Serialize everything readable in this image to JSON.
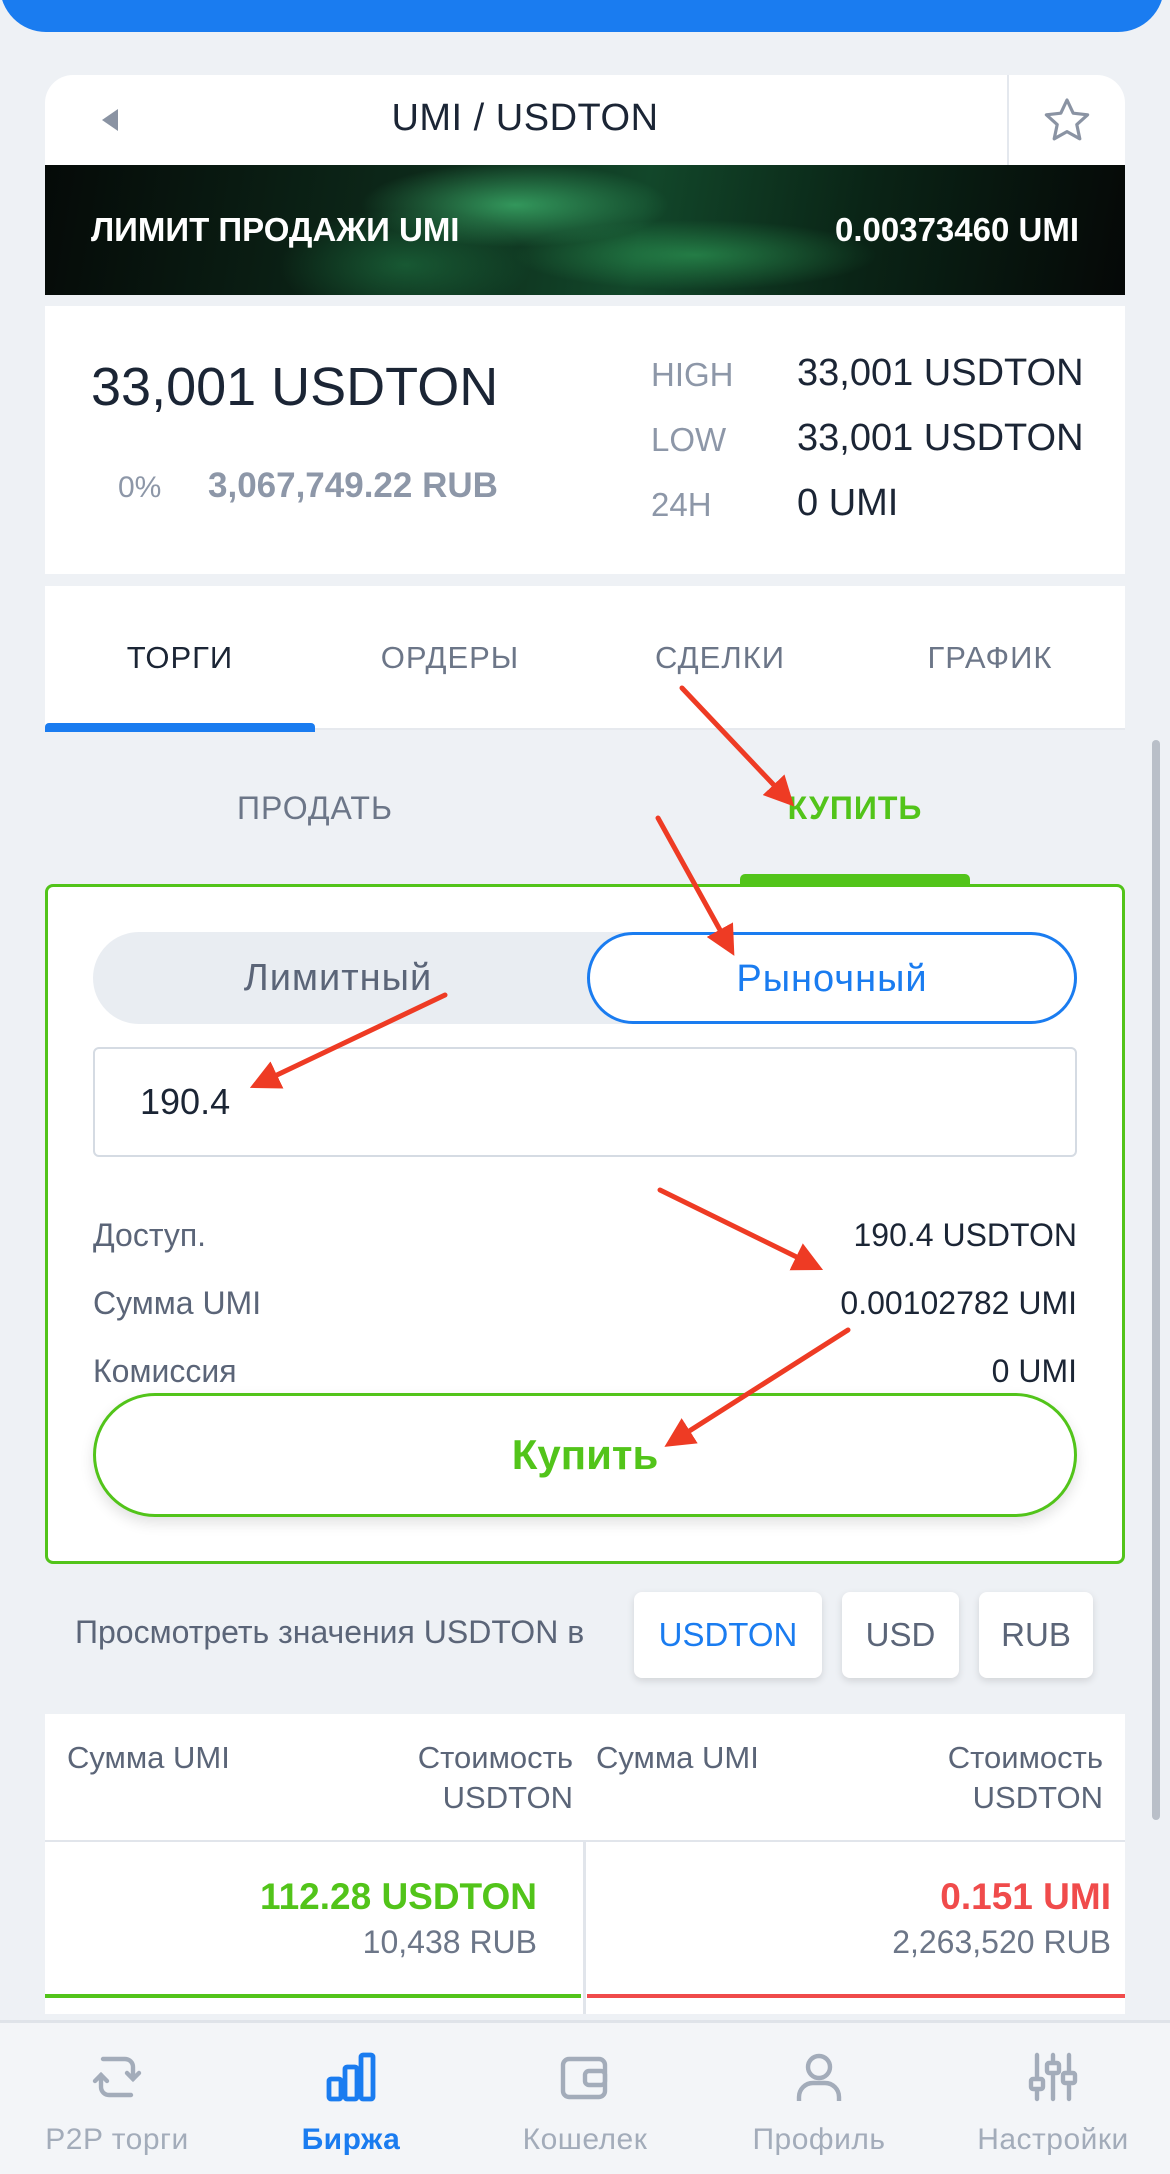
{
  "header": {
    "pair": "UMI / USDTON"
  },
  "banner": {
    "left": "ЛИМИТ ПРОДАЖИ UMI",
    "right": "0.00373460 UMI"
  },
  "stats": {
    "price": "33,001 USDTON",
    "change": "0%",
    "rub": "3,067,749.22 RUB",
    "high_label": "HIGH",
    "high": "33,001 USDTON",
    "low_label": "LOW",
    "low": "33,001 USDTON",
    "vol_label": "24H",
    "vol": "0 UMI"
  },
  "tabs": [
    "ТОРГИ",
    "ОРДЕРЫ",
    "СДЕЛКИ",
    "ГРАФИК"
  ],
  "side": {
    "sell": "ПРОДАТЬ",
    "buy": "КУПИТЬ"
  },
  "order": {
    "limit": "Лимитный",
    "market": "Рыночный",
    "amount": "190.4",
    "avail_label": "Доступ.",
    "avail": "190.4 USDTON",
    "sum_label": "Сумма UMI",
    "sum": "0.00102782 UMI",
    "fee_label": "Комиссия",
    "fee": "0 UMI",
    "buy_button": "Купить"
  },
  "view": {
    "label": "Просмотреть значения USDTON в",
    "options": [
      "USDTON",
      "USD",
      "RUB"
    ]
  },
  "book": {
    "h1": "Сумма UMI",
    "h2a": "Стоимость",
    "h2b": "USDTON",
    "h3": "Сумма UMI",
    "h4a": "Стоимость",
    "h4b": "USDTON",
    "bid_value": "112.28 USDTON",
    "bid_rub": "10,438 RUB",
    "ask_value": "0.151 UMI",
    "ask_rub": "2,263,520 RUB"
  },
  "nav": [
    "P2P торги",
    "Биржа",
    "Кошелек",
    "Профиль",
    "Настройки"
  ],
  "colors": {
    "accent": "#1a7cf0",
    "buy": "#52c41a",
    "sell": "#f04b4b",
    "annotation": "#ee3b24"
  }
}
